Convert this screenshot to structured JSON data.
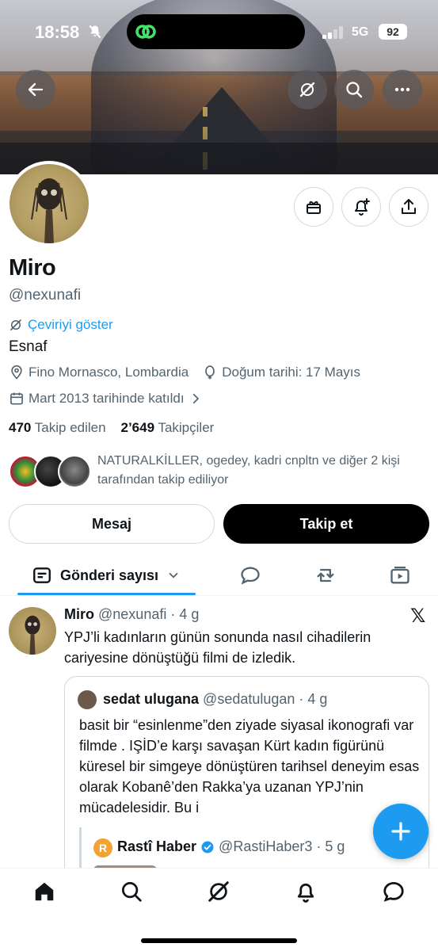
{
  "status_bar": {
    "time": "18:58",
    "network": "5G",
    "battery": "92"
  },
  "profile": {
    "name": "Miro",
    "handle": "@nexunafi",
    "translate_label": "Çeviriyi göster",
    "bio": "Esnaf",
    "location": "Fino Mornasco, Lombardia",
    "birthday": "Doğum tarihi: 17 Mayıs",
    "joined": "Mart 2013 tarihinde katıldı",
    "following_count": "470",
    "following_label": "Takip edilen",
    "followers_count": "2’649",
    "followers_label": "Takipçiler",
    "followed_by": "NATURALKİLLER, ogedey, kadri cnpltn ve diğer 2 kişi tarafından takip ediliyor"
  },
  "actions": {
    "message": "Mesaj",
    "follow": "Takip et"
  },
  "tabs": {
    "posts_label": "Gönderi sayısı"
  },
  "post": {
    "author": "Miro",
    "handle": "@nexunafi",
    "time": "· 4 g",
    "text": "YPJ’li kadınların günün sonunda nasıl cihadilerin cariyesine dönüştüğü filmi de izledik.",
    "quote": {
      "author": "sedat ulugana",
      "handle": "@sedatulugan",
      "time": "· 4 g",
      "text": "basit bir “esinlenme”den ziyade  siyasal ikonografi var filmde . IŞİD’e karşı savaşan Kürt kadın figürünü küresel bir simgeye dönüştüren tarihsel deneyim esas olarak Kobanê’den Rakka’ya uzanan YPJ’nin mücadelesidir. Bu i",
      "nested": {
        "avatar_letter": "R",
        "author": "Rastî Haber",
        "handle": "@RastiHaber3",
        "time": "· 5 g"
      }
    }
  },
  "colors": {
    "accent": "#1d9bf0",
    "text": "#0f1419",
    "muted": "#536471"
  }
}
